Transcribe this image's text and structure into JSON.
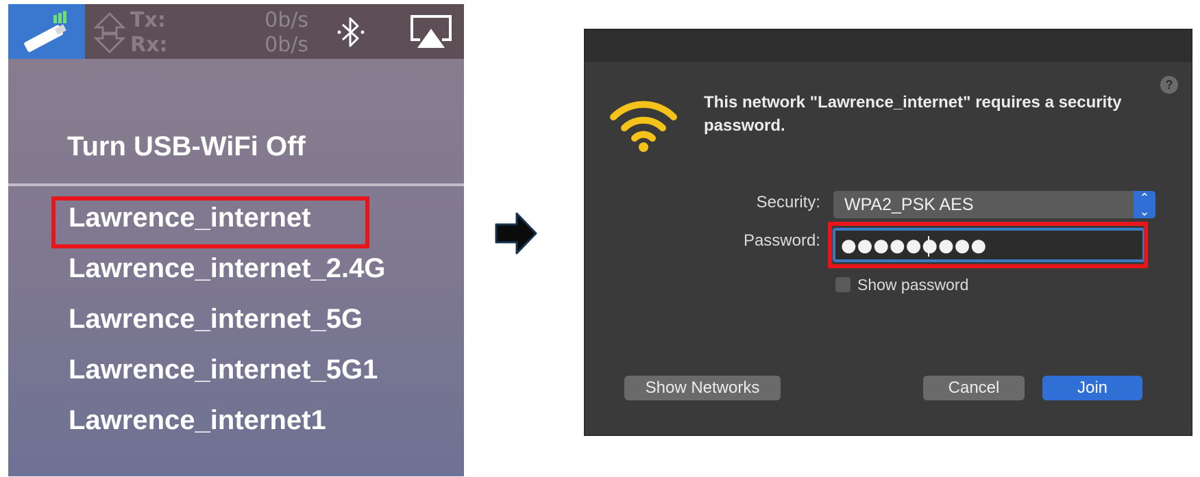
{
  "menubar": {
    "tx_label": "Tx:",
    "rx_label": "Rx:",
    "tx_rate": "0b/s",
    "rx_rate": "0b/s",
    "icons": {
      "tray": "usb-wifi-icon",
      "traffic": "tx-rx-arrows-icon",
      "bluetooth": "bluetooth-icon",
      "airplay": "airplay-icon"
    }
  },
  "menu": {
    "turn_off_label": "Turn USB-WiFi Off",
    "networks": [
      "Lawrence_internet",
      "Lawrence_internet_2.4G",
      "Lawrence_internet_5G",
      "Lawrence_internet_5G1",
      "Lawrence_internet1"
    ]
  },
  "dialog": {
    "help_label": "?",
    "message": "This network \"Lawrence_internet\" requires a security password.",
    "security_label": "Security:",
    "security_value": "WPA2_PSK AES",
    "password_label": "Password:",
    "password_value": "●●●●●●●●●",
    "show_password_label": "Show password",
    "show_password_checked": false,
    "buttons": {
      "show_networks": "Show Networks",
      "cancel": "Cancel",
      "join": "Join"
    }
  },
  "colors": {
    "highlight_red": "#e8161b",
    "accent_blue": "#2f6fd6",
    "wifi_yellow": "#f4c21a"
  }
}
